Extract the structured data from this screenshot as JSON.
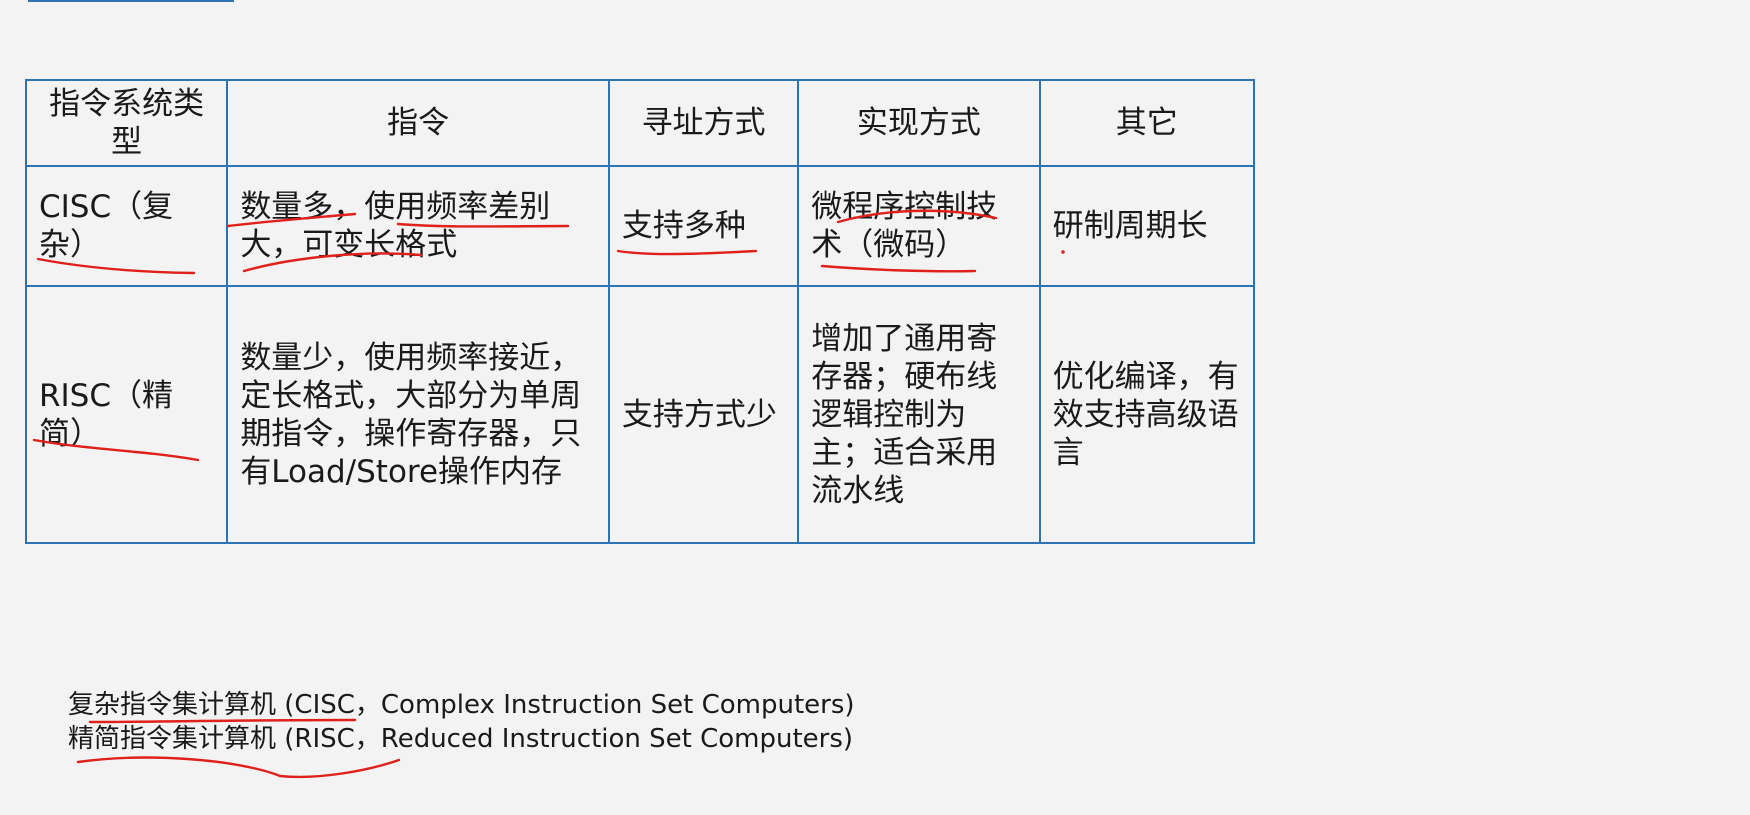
{
  "table": {
    "headers": [
      "指令系统类型",
      "指令",
      "寻址方式",
      "实现方式",
      "其它"
    ],
    "rows": [
      {
        "type": "CISC（复杂）",
        "instruction": "数量多，使用频率差别大，可变长格式",
        "addressing": "支持多种",
        "implementation": "微程序控制技术（微码）",
        "other": "研制周期长"
      },
      {
        "type": "RISC（精简）",
        "instruction": "数量少，使用频率接近，定长格式，大部分为单周期指令，操作寄存器，只有Load/Store操作内存",
        "addressing": "支持方式少",
        "implementation": "增加了通用寄存器；硬布线逻辑控制为主；适合采用流水线",
        "other": "优化编译，有效支持高级语言"
      }
    ]
  },
  "footer": {
    "line1": "复杂指令集计算机 (CISC，Complex Instruction Set Computers)",
    "line2": "精简指令集计算机 (RISC，Reduced Instruction Set Computers)"
  },
  "annotations": {
    "pen_color": "#e0201b"
  }
}
